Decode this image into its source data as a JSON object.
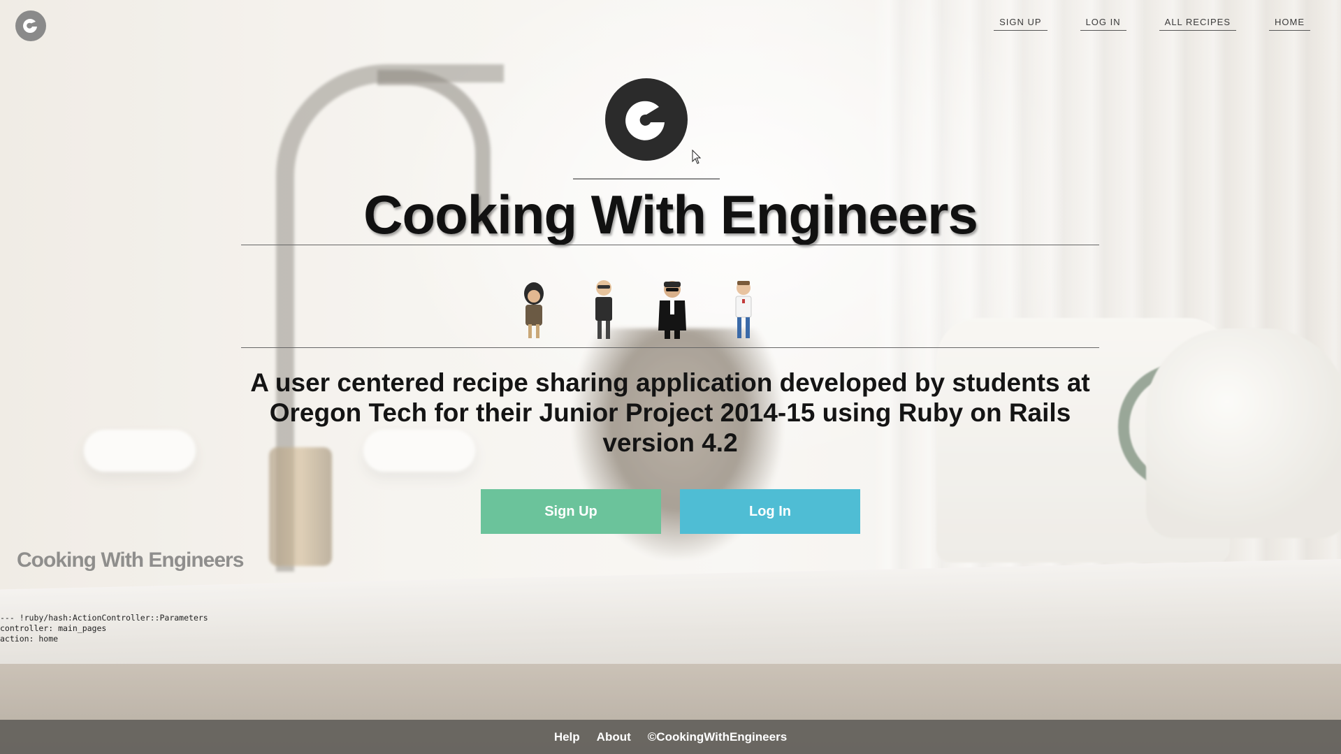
{
  "site": {
    "title": "Cooking With Engineers"
  },
  "nav": {
    "items": [
      {
        "label": "SIGN UP"
      },
      {
        "label": "LOG IN"
      },
      {
        "label": "ALL RECIPES"
      },
      {
        "label": "HOME"
      }
    ]
  },
  "hero": {
    "title": "Cooking With Engineers",
    "tagline": "A user centered recipe sharing application developed by students at Oregon Tech for their Junior Project 2014-15 using Ruby on Rails version 4.2",
    "signup_button": "Sign Up",
    "login_button": "Log In",
    "avatars": [
      "engineer-avatar-1",
      "engineer-avatar-2",
      "engineer-avatar-3",
      "engineer-avatar-4"
    ]
  },
  "watermark": "Cooking With Engineers",
  "debug": "--- !ruby/hash:ActionController::Parameters\ncontroller: main_pages\naction: home",
  "footer": {
    "help": "Help",
    "about": "About",
    "copyright": "©CookingWithEngineers"
  },
  "colors": {
    "signup": "#6bc39b",
    "login": "#4fbdd4",
    "logo": "#2b2b2b",
    "footer": "#5f5c58"
  }
}
